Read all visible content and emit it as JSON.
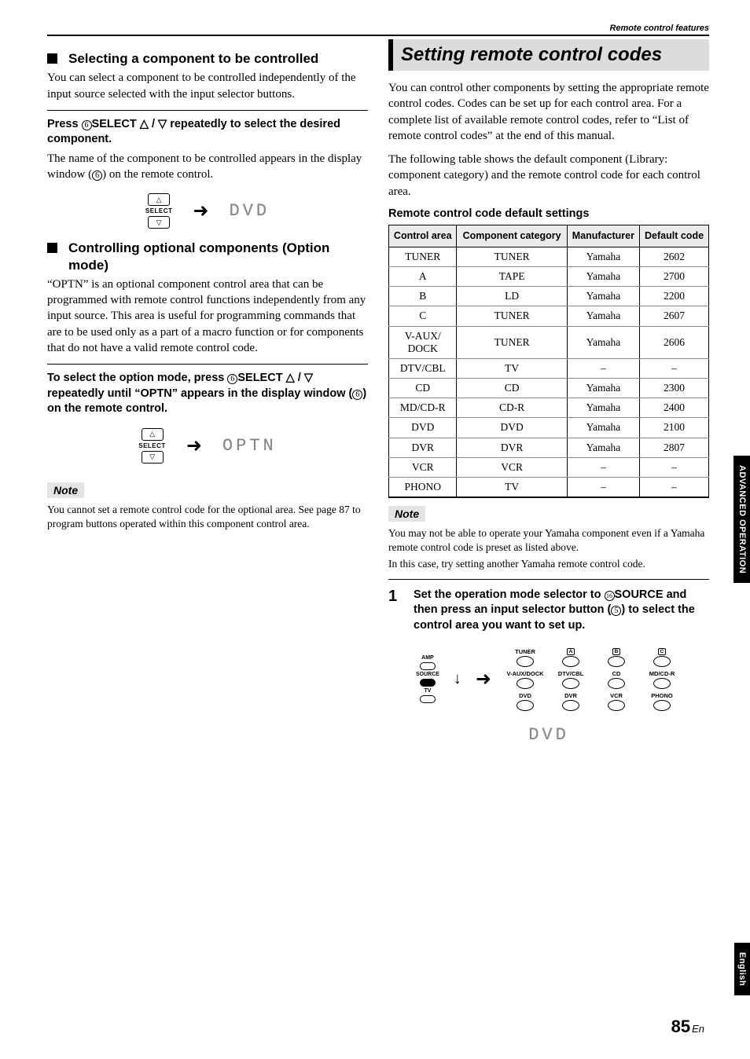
{
  "header_label": "Remote control features",
  "left": {
    "h_select": "Selecting a component to be controlled",
    "p_select": "You can select a component to be controlled independently of the input source selected with the input selector buttons.",
    "instr_select_pre": "Press ",
    "instr_select_mid": "SELECT",
    "instr_select_post": " repeatedly to select the desired component.",
    "p_select_result": "The name of the component to be controlled appears in the display window (",
    "p_select_result_end": ") on the remote control.",
    "lcd1": "DVD",
    "h_option": "Controlling optional components (Option mode)",
    "p_option": "“OPTN” is an optional component control area that can be programmed with remote control functions independently from any input source. This area is useful for programming commands that are to be used only as a part of a macro function or for components that do not have a valid remote control code.",
    "instr_option_pre": "To select the option mode, press ",
    "instr_option_mid": "SELECT",
    "instr_option_post": " repeatedly until “OPTN” appears in the display window (",
    "instr_option_end": ") on the remote control.",
    "lcd2": "OPTN",
    "note_label": "Note",
    "note_text": "You cannot set a remote control code for the optional area. See page 87 to program buttons operated within this component control area."
  },
  "right": {
    "section_title": "Setting remote control codes",
    "p_intro": "You can control other components by setting the appropriate remote control codes. Codes can be set up for each control area. For a complete list of available remote control codes, refer to “List of remote control codes” at the end of this manual.",
    "p_table_intro": "The following table shows the default component (Library: component category) and the remote control code for each control area.",
    "table_title": "Remote control code default settings",
    "headers": [
      "Control area",
      "Component category",
      "Manufacturer",
      "Default code"
    ],
    "rows": [
      [
        "TUNER",
        "TUNER",
        "Yamaha",
        "2602"
      ],
      [
        "A",
        "TAPE",
        "Yamaha",
        "2700"
      ],
      [
        "B",
        "LD",
        "Yamaha",
        "2200"
      ],
      [
        "C",
        "TUNER",
        "Yamaha",
        "2607"
      ],
      [
        "V-AUX/\nDOCK",
        "TUNER",
        "Yamaha",
        "2606"
      ],
      [
        "DTV/CBL",
        "TV",
        "–",
        "–"
      ],
      [
        "CD",
        "CD",
        "Yamaha",
        "2300"
      ],
      [
        "MD/CD-R",
        "CD-R",
        "Yamaha",
        "2400"
      ],
      [
        "DVD",
        "DVD",
        "Yamaha",
        "2100"
      ],
      [
        "DVR",
        "DVR",
        "Yamaha",
        "2807"
      ],
      [
        "VCR",
        "VCR",
        "–",
        "–"
      ],
      [
        "PHONO",
        "TV",
        "–",
        "–"
      ]
    ],
    "note_label": "Note",
    "note_p1": "You may not be able to operate your Yamaha component even if a Yamaha remote control code is preset as listed above.",
    "note_p2": "In this case, try setting another Yamaha remote control code.",
    "step1_num": "1",
    "step1_pre": "Set the operation mode selector to ",
    "step1_source": "SOURCE",
    "step1_mid": " and then press an input selector button (",
    "step1_post": ") to select the control area you want to set up.",
    "mode_labels": [
      "AMP",
      "SOURCE",
      "TV"
    ],
    "input_buttons_r1": [
      "TUNER",
      "A",
      "B",
      "C"
    ],
    "input_buttons_r2": [
      "V-AUX/DOCK",
      "DTV/CBL",
      "CD",
      "MD/CD-R"
    ],
    "input_buttons_r3": [
      "DVD",
      "DVR",
      "VCR",
      "PHONO"
    ],
    "lcd3": "DVD"
  },
  "tabs": {
    "advanced": "ADVANCED OPERATION",
    "english": "English"
  },
  "page_number": "85",
  "page_suffix": "En"
}
